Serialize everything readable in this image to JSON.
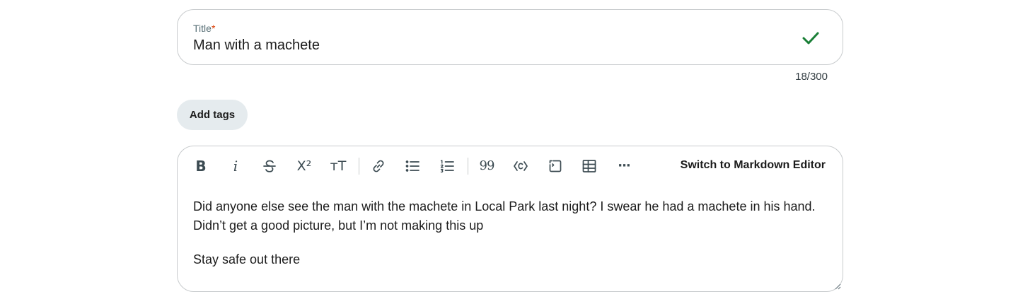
{
  "title_field": {
    "label": "Title",
    "required_mark": "*",
    "value": "Man with a machete",
    "counter": "18/300",
    "valid_icon": "check-icon",
    "valid_color": "#1a7f37"
  },
  "tags": {
    "button_label": "Add tags"
  },
  "editor": {
    "toolbar": {
      "bold_glyph": "B",
      "italic_glyph": "i",
      "superscript_glyph": "X²",
      "heading_glyph": "ᴛT",
      "quote_glyph": "99",
      "more_glyph": "···",
      "icons": [
        "bold-icon",
        "italic-icon",
        "strikethrough-icon",
        "superscript-icon",
        "heading-icon",
        "link-icon",
        "bulleted-list-icon",
        "numbered-list-icon",
        "quote-icon",
        "code-icon",
        "code-block-icon",
        "table-icon",
        "more-icon"
      ],
      "switch_label": "Switch to Markdown Editor"
    },
    "paragraphs": [
      "Did anyone else see the man with the machete in Local Park last night? I swear he had a machete in his hand. Didn’t get a good picture, but I’m not making this up",
      "Stay safe out there"
    ]
  }
}
